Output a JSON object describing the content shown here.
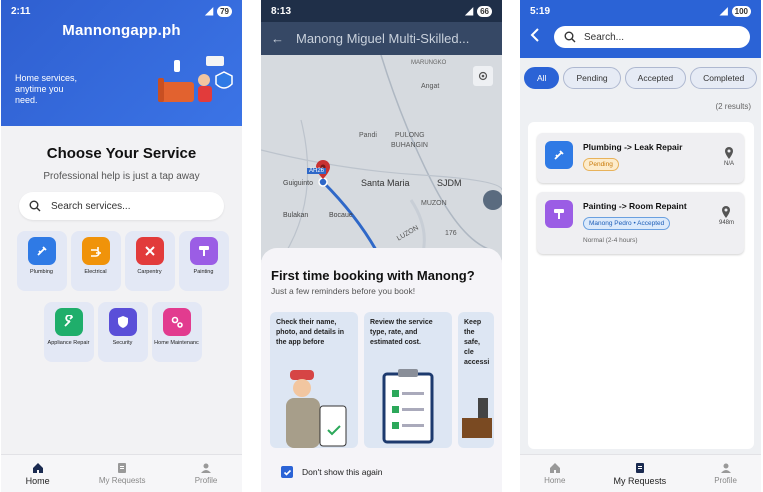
{
  "home": {
    "status": {
      "time": "2:11",
      "battery": "79"
    },
    "brand": "Mannongapp.ph",
    "tagline": "Home services, anytime you need.",
    "heading": "Choose Your Service",
    "subheading": "Professional help is just a tap away",
    "search_placeholder": "Search services...",
    "services": [
      {
        "label": "Plumbing",
        "color": "#2f7ae5",
        "icon": "plumbing-icon"
      },
      {
        "label": "Electrical",
        "color": "#f0930a",
        "icon": "electrical-icon"
      },
      {
        "label": "Carpentry",
        "color": "#e23b3b",
        "icon": "carpentry-icon"
      },
      {
        "label": "Painting",
        "color": "#9b5de5",
        "icon": "painting-icon"
      },
      {
        "label": "Appliance Repair",
        "color": "#1fae6b",
        "icon": "wrench-icon"
      },
      {
        "label": "Security",
        "color": "#5a4fd8",
        "icon": "shield-icon"
      },
      {
        "label": "Home Maintenanc",
        "color": "#e23b8f",
        "icon": "gears-icon"
      }
    ],
    "nav": {
      "home": "Home",
      "requests": "My Requests",
      "profile": "Profile"
    }
  },
  "booking": {
    "status": {
      "time": "8:13",
      "battery": "66"
    },
    "title": "Manong Miguel Multi-Skilled...",
    "map_labels": {
      "marungko": "MARUNGKO",
      "angat": "Angat",
      "pandi": "Pandi",
      "pulong": "PULONG",
      "buhangin": "BUHANGIN",
      "guiguinto": "Guiguinto",
      "santa_maria": "Santa Maria",
      "sjdm": "SJDM",
      "muzon": "MUZON",
      "bulakan": "Bulakan",
      "bocaue": "Bocaue",
      "luzon": "LUZON",
      "road": "AH26",
      "num": "176"
    },
    "sheet_title": "First time booking with Manong?",
    "sheet_hint": "Just a few reminders before you book!",
    "tips": [
      "Check their name, photo, and details in the app before",
      "Review the service type, rate, and estimated cost.",
      "Keep the safe, cle accessi"
    ],
    "dont_show": "Don't show this again"
  },
  "requests": {
    "status": {
      "time": "5:19",
      "battery": "100"
    },
    "search_placeholder": "Search...",
    "chips": [
      "All",
      "Pending",
      "Accepted",
      "Completed"
    ],
    "results": "(2 results)",
    "items": [
      {
        "title": "Plumbing -> Leak Repair",
        "badge": "Pending",
        "distance": "N/A",
        "color": "#2f7ae5"
      },
      {
        "title": "Painting -> Room Repaint",
        "badge": "Manong Pedro • Accepted",
        "note": "Normal (2-4 hours)",
        "distance": "948m",
        "color": "#9b5de5"
      }
    ],
    "nav": {
      "home": "Home",
      "requests": "My Requests",
      "profile": "Profile"
    }
  }
}
